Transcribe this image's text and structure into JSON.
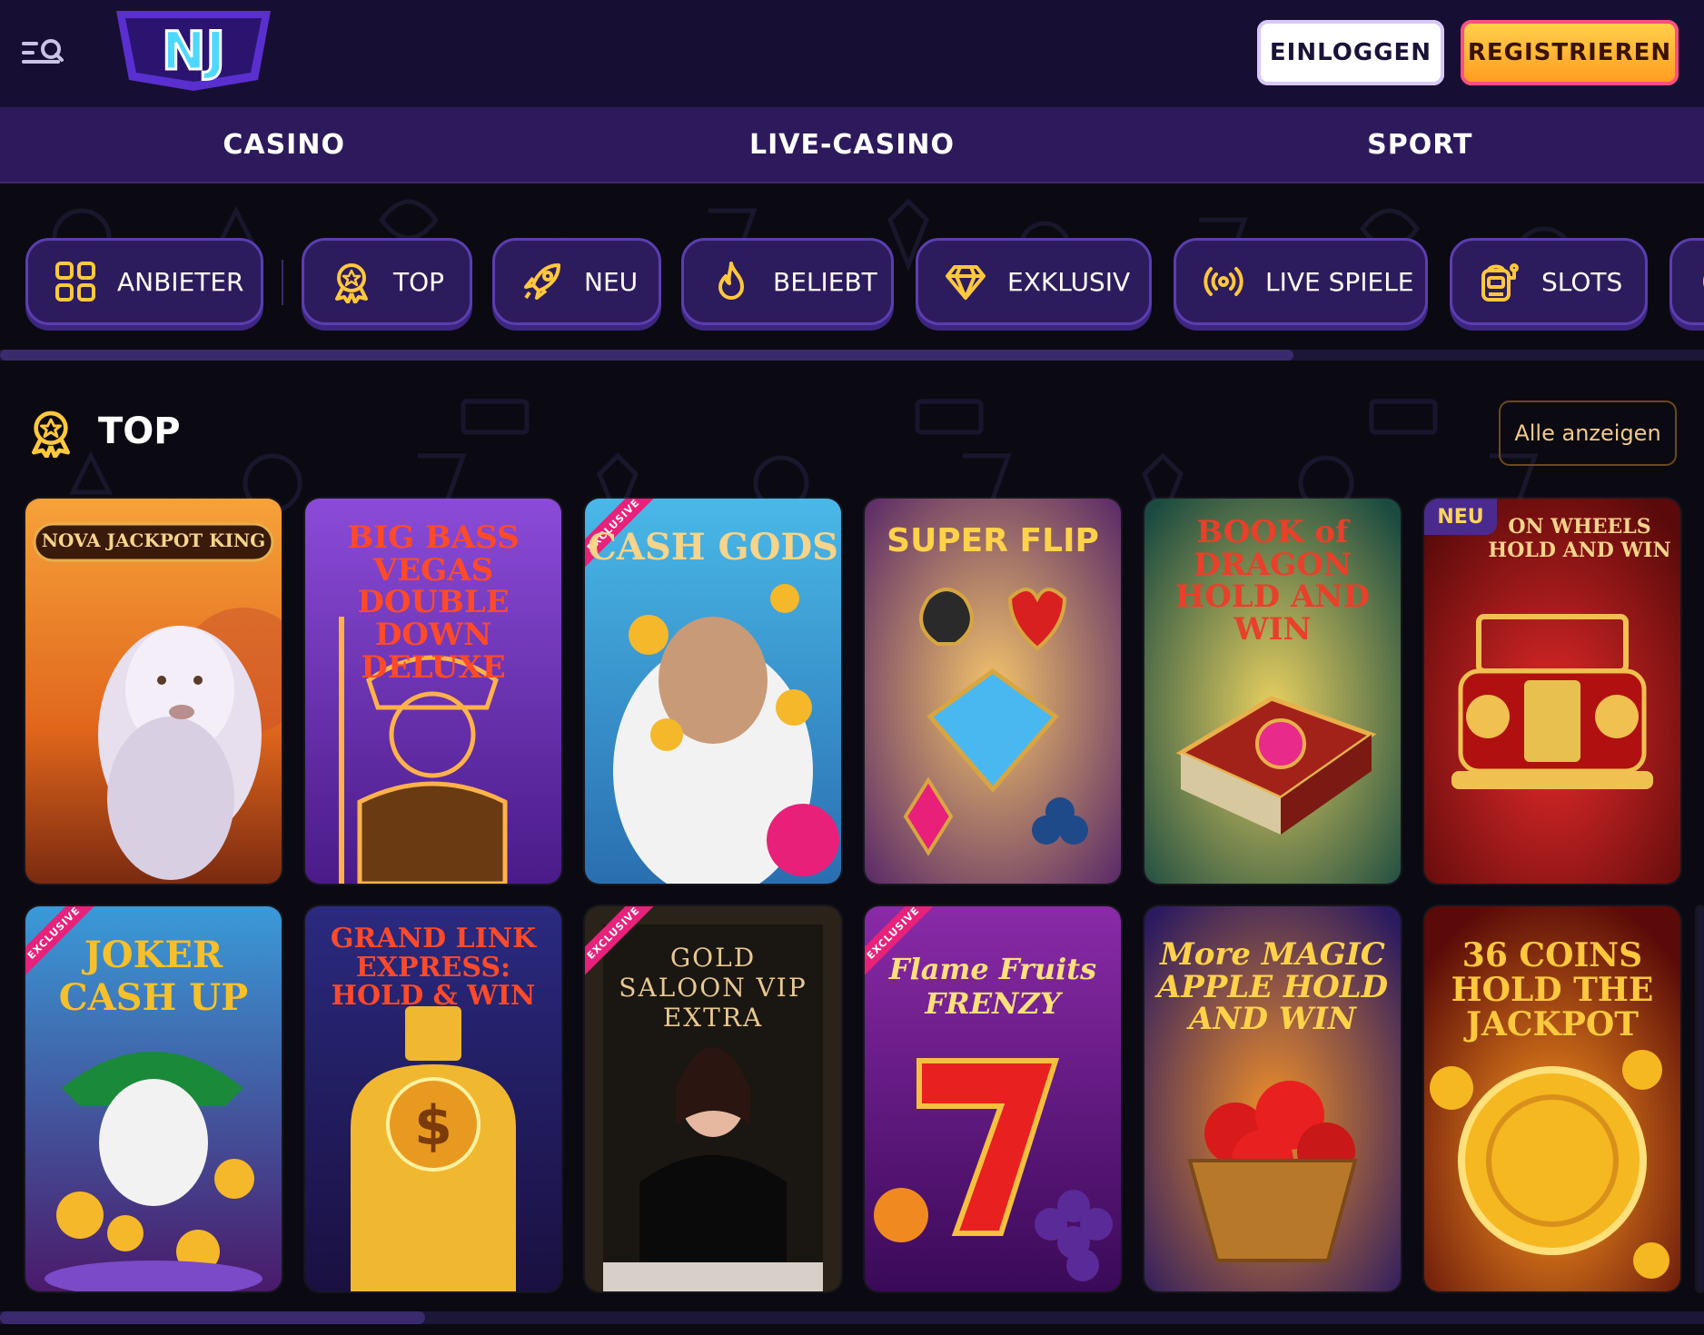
{
  "header": {
    "logo_text": "NJ",
    "login_label": "EINLOGGEN",
    "register_label": "REGISTRIEREN"
  },
  "nav": {
    "tabs": [
      {
        "label": "CASINO"
      },
      {
        "label": "LIVE-CASINO"
      },
      {
        "label": "SPORT"
      }
    ]
  },
  "categories": [
    {
      "label": "ANBIETER",
      "icon": "grid-icon"
    },
    {
      "label": "TOP",
      "icon": "award-icon"
    },
    {
      "label": "NEU",
      "icon": "rocket-icon"
    },
    {
      "label": "BELIEBT",
      "icon": "flame-icon"
    },
    {
      "label": "EXKLUSIV",
      "icon": "diamond-icon"
    },
    {
      "label": "LIVE SPIELE",
      "icon": "broadcast-icon"
    },
    {
      "label": "SLOTS",
      "icon": "slot-machine-icon"
    }
  ],
  "section": {
    "title": "TOP",
    "icon": "award-icon",
    "show_all_label": "Alle anzeigen"
  },
  "games": [
    {
      "title": "NOVA JACKPOT KING",
      "badge": ""
    },
    {
      "title": "BIG BASS VEGAS DOUBLE DOWN DELUXE",
      "badge": ""
    },
    {
      "title": "CASH GODS",
      "badge": "EXCLUSIVE"
    },
    {
      "title": "SUPER FLIP",
      "badge": ""
    },
    {
      "title": "BOOK of DRAGON HOLD AND WIN",
      "badge": ""
    },
    {
      "title": "ON WHEELS HOLD AND WIN",
      "badge": "NEU"
    },
    {
      "title": "JOKER CASH UP",
      "badge": "EXCLUSIVE"
    },
    {
      "title": "GRAND LINK EXPRESS: HOLD & WIN",
      "badge": ""
    },
    {
      "title": "GOLD SALOON VIP EXTRA",
      "badge": "EXCLUSIVE"
    },
    {
      "title": "Flame Fruits FRENZY",
      "badge": "EXCLUSIVE"
    },
    {
      "title": "More MAGIC APPLE HOLD AND WIN",
      "badge": ""
    },
    {
      "title": "36 COINS HOLD THE JACKPOT",
      "badge": ""
    }
  ],
  "colors": {
    "header_bg": "#170f33",
    "nav_bg": "#2d1a5c",
    "category_bg": "#2d1c5d",
    "category_border": "#5b3eb0",
    "accent_gold": "#ffc83d",
    "register_gradient": [
      "#ffd34d",
      "#ff9a1f"
    ]
  }
}
